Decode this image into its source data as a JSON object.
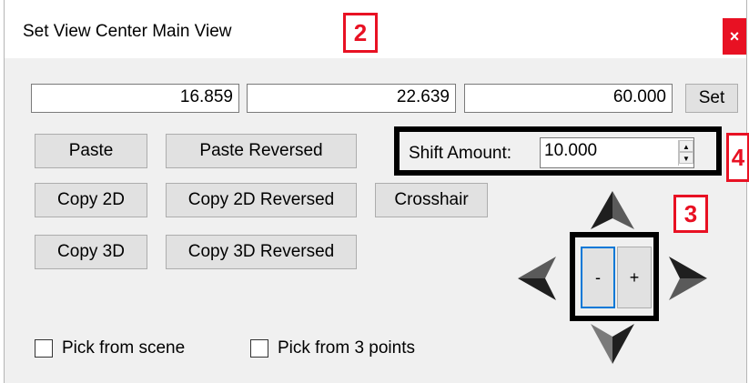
{
  "window": {
    "title": "Set View Center Main View",
    "close_label": "×"
  },
  "coords": {
    "x": "16.859",
    "y": "22.639",
    "z": "60.000",
    "set_label": "Set"
  },
  "buttons": {
    "paste": "Paste",
    "paste_reversed": "Paste Reversed",
    "copy_2d": "Copy 2D",
    "copy_2d_reversed": "Copy 2D Reversed",
    "crosshair": "Crosshair",
    "copy_3d": "Copy 3D",
    "copy_3d_reversed": "Copy 3D Reversed"
  },
  "shift": {
    "label": "Shift Amount:",
    "value": "10.000"
  },
  "zoom": {
    "minus_label": "-",
    "plus_label": "+"
  },
  "checks": {
    "pick_scene": "Pick from scene",
    "pick_3points": "Pick from 3 points"
  },
  "markers": {
    "m2": "2",
    "m3": "3",
    "m4": "4"
  },
  "icons": {
    "up": "arrow-up-icon",
    "down": "arrow-down-icon",
    "left": "arrow-left-icon",
    "right": "arrow-right-icon"
  },
  "colors": {
    "accent_red": "#e81123",
    "focus_blue": "#0078d7"
  }
}
